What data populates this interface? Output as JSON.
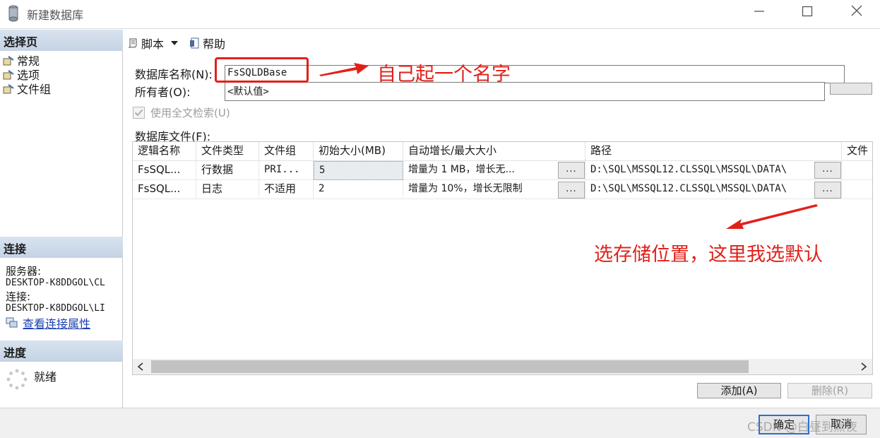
{
  "window": {
    "title": "新建数据库"
  },
  "left": {
    "select_page_title": "选择页",
    "pages": [
      {
        "label": "常规"
      },
      {
        "label": "选项"
      },
      {
        "label": "文件组"
      }
    ],
    "connection_title": "连接",
    "server_label": "服务器:",
    "server_value": "DESKTOP-K8DDGOL\\CL",
    "connection_label": "连接:",
    "connection_value": "DESKTOP-K8DDGOL\\LI",
    "view_props_link": "查看连接属性",
    "progress_title": "进度",
    "progress_status": "就绪"
  },
  "toolbar": {
    "script_label": "脚本",
    "help_label": "帮助"
  },
  "form": {
    "db_name_label": "数据库名称(N):",
    "db_name_value": "FsSQLDBase",
    "owner_label": "所有者(O):",
    "owner_value": "<默认值>",
    "fulltext_label": "使用全文检索(U)",
    "db_files_label": "数据库文件(F):"
  },
  "grid": {
    "headers": [
      "逻辑名称",
      "文件类型",
      "文件组",
      "初始大小(MB)",
      "自动增长/最大大小",
      "路径",
      "文件"
    ],
    "rows": [
      {
        "logical": "FsSQL...",
        "type": "行数据",
        "filegroup": "PRI...",
        "size": "5",
        "growth": "增量为 1 MB，增长无...",
        "path": "D:\\SQL\\MSSQL12.CLSSQL\\MSSQL\\DATA\\"
      },
      {
        "logical": "FsSQL...",
        "type": "日志",
        "filegroup": "不适用",
        "size": "2",
        "growth": "增量为 10%，增长无限制",
        "path": "D:\\SQL\\MSSQL12.CLSSQL\\MSSQL\\DATA\\"
      }
    ],
    "ellipsis": "..."
  },
  "buttons": {
    "add": "添加(A)",
    "remove": "删除(R)",
    "ok": "确定",
    "cancel": "取消"
  },
  "annotations": {
    "name_hint": "自己起一个名字",
    "location_hint": "选存储位置，这里我选默认"
  },
  "watermark": "CSDN @白昼到黑夜",
  "colors": {
    "annotation_red": "#e0211a",
    "header_blue": "#c4d3e4",
    "link_blue": "#1a3fb0"
  }
}
